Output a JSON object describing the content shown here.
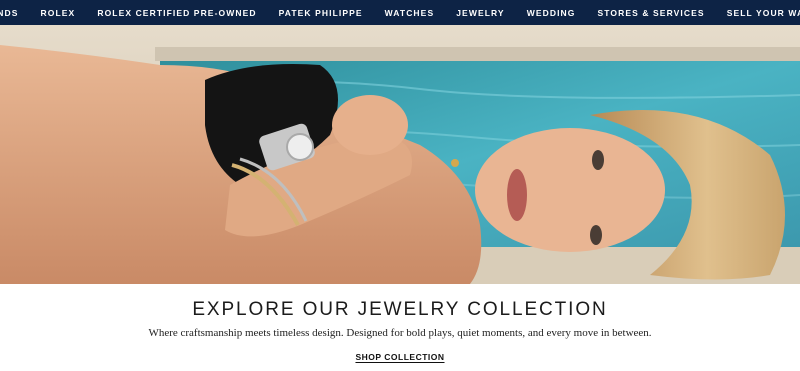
{
  "nav": {
    "items": [
      {
        "label": "BRANDS"
      },
      {
        "label": "ROLEX"
      },
      {
        "label": "ROLEX CERTIFIED PRE-OWNED"
      },
      {
        "label": "PATEK PHILIPPE"
      },
      {
        "label": "WATCHES"
      },
      {
        "label": "JEWELRY"
      },
      {
        "label": "WEDDING"
      },
      {
        "label": "STORES & SERVICES"
      },
      {
        "label": "SELL YOUR WATCH"
      }
    ]
  },
  "promo": {
    "heading": "EXPLORE OUR JEWELRY COLLECTION",
    "subtext": "Where craftsmanship meets timeless design. Designed for bold plays, quiet moments, and every move in between.",
    "cta_label": "SHOP COLLECTION"
  },
  "colors": {
    "nav_background": "#0d2345",
    "nav_text": "#ffffff",
    "heading_text": "#1b1b1b"
  }
}
